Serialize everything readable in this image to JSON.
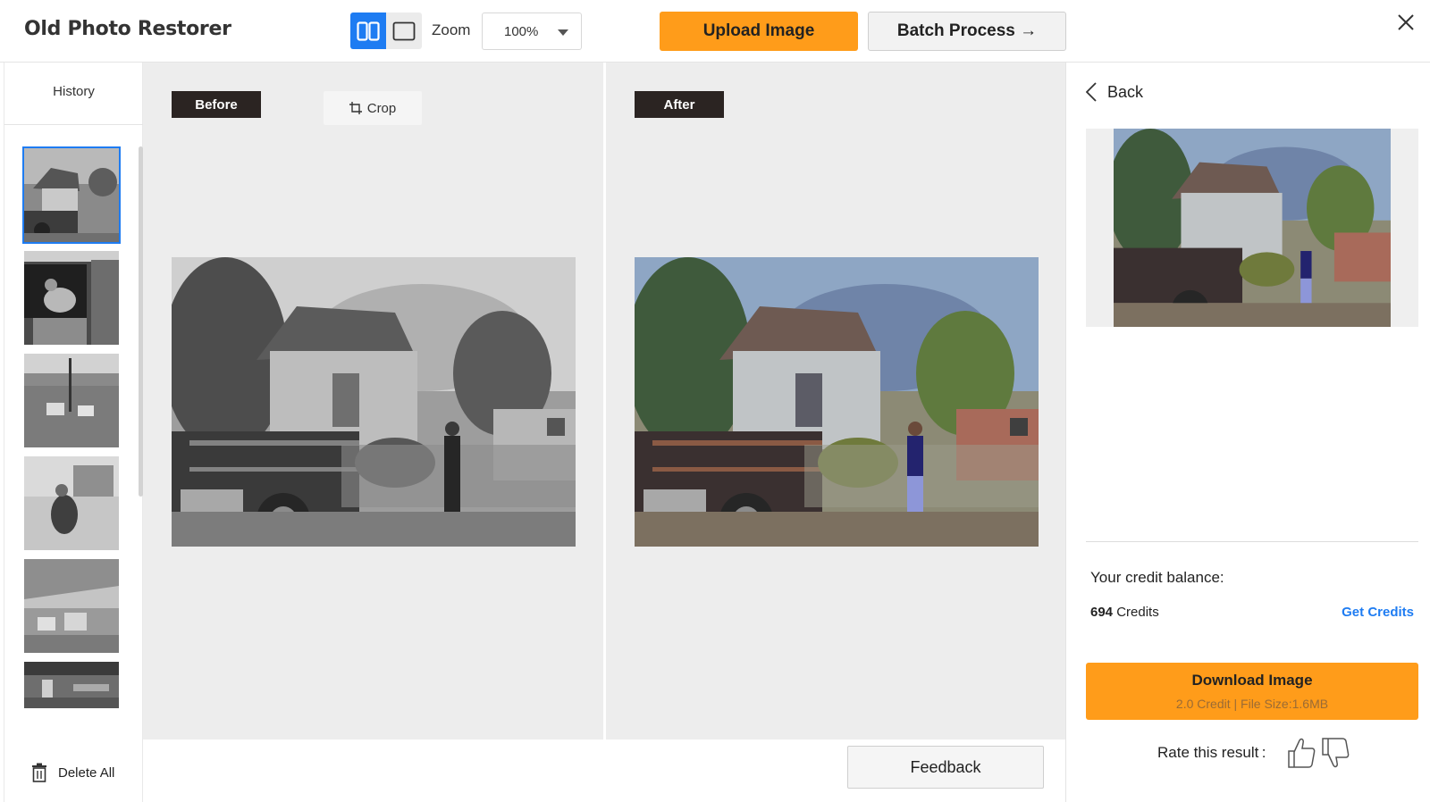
{
  "app": {
    "title": "Old Photo Restorer"
  },
  "toolbar": {
    "zoom_label": "Zoom",
    "zoom_value": "100%",
    "upload_label": "Upload Image",
    "batch_label": "Batch Process →"
  },
  "history": {
    "title": "History",
    "delete_all_label": "Delete All",
    "items": [
      {
        "name": "fire-truck-house",
        "selected": true
      },
      {
        "name": "workshop-man",
        "selected": false
      },
      {
        "name": "park-lawn",
        "selected": false
      },
      {
        "name": "girl-swing",
        "selected": false
      },
      {
        "name": "museum-room",
        "selected": false
      },
      {
        "name": "hall-interior",
        "selected": false
      }
    ]
  },
  "compare": {
    "before_label": "Before",
    "after_label": "After",
    "crop_label": "Crop"
  },
  "footer": {
    "feedback_label": "Feedback"
  },
  "panel": {
    "back_label": "Back",
    "credit_balance_label": "Your credit balance:",
    "credit_amount": "694",
    "credit_unit": " Credits",
    "get_credits_label": "Get Credits",
    "download_label": "Download Image",
    "download_sub": "2.0 Credit | File Size:1.6MB",
    "rate_label": "Rate this result :"
  },
  "colors": {
    "accent_orange": "#ff9c1a",
    "accent_blue": "#1e7cf2",
    "tag_dark": "#2b2422"
  },
  "icons": [
    "split-view-icon",
    "single-view-icon",
    "chevron-down-icon",
    "close-icon",
    "crop-icon",
    "trash-icon",
    "chevron-left-icon",
    "thumbs-up-icon",
    "thumbs-down-icon"
  ]
}
